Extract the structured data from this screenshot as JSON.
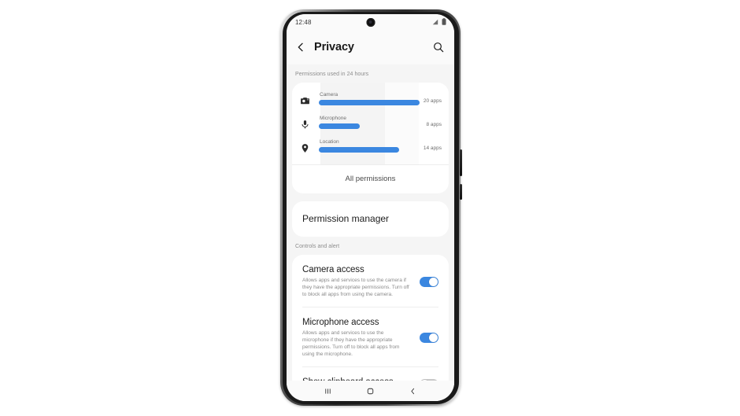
{
  "device": {
    "status_bar": {
      "clock": "12:48",
      "signal_icon": "signal-bars-icon",
      "battery_icon": "battery-icon",
      "camera_icon": "front-camera-punch-hole"
    },
    "nav_bar": {
      "recents_label": "|||",
      "recents_icon": "recents-icon",
      "home_icon": "home-icon",
      "back_icon": "back-icon"
    }
  },
  "appbar": {
    "back_icon": "back-chevron-icon",
    "title": "Privacy",
    "search_icon": "search-icon"
  },
  "usage": {
    "section_label": "Permissions used in 24 hours",
    "all_permissions_label": "All permissions",
    "accent_color": "#3b87e0"
  },
  "chart_data": {
    "type": "bar",
    "title": "Permissions used in 24 hours",
    "orientation": "horizontal",
    "categories": [
      "Camera",
      "Microphone",
      "Location"
    ],
    "values": [
      20,
      8,
      14
    ],
    "value_labels": [
      "20 apps",
      "8 apps",
      "14 apps"
    ],
    "icons": [
      "camera-icon",
      "microphone-icon",
      "location-icon"
    ],
    "xlabel": "",
    "ylabel": "",
    "xlim": [
      0,
      20
    ],
    "grid": false,
    "legend": false,
    "bar_color": "#3b87e0"
  },
  "permission_manager": {
    "label": "Permission manager"
  },
  "controls": {
    "section_label": "Controls and alert",
    "items": [
      {
        "title": "Camera access",
        "description": "Allows apps and services to use the camera if they have the appropriate permissions. Turn off to block all apps from using the camera.",
        "toggle_state": "on"
      },
      {
        "title": "Microphone access",
        "description": "Allows apps and services to use the microphone if they have the appropriate permissions. Turn off to block all apps from using the microphone.",
        "toggle_state": "on"
      },
      {
        "title": "Show clipboard access",
        "description": "",
        "toggle_state": "off"
      }
    ]
  }
}
